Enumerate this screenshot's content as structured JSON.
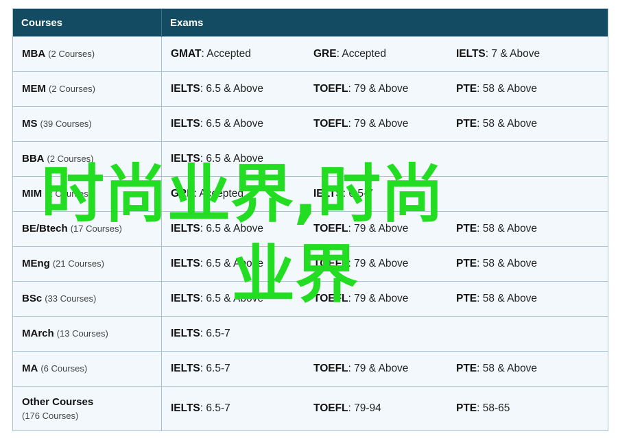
{
  "headers": {
    "courses": "Courses",
    "exams": "Exams"
  },
  "rows": [
    {
      "name": "MBA",
      "count": "(2 Courses)",
      "exams": [
        {
          "name": "GMAT",
          "score": ": Accepted"
        },
        {
          "name": "GRE",
          "score": ": Accepted"
        },
        {
          "name": "IELTS",
          "score": ": 7 & Above"
        }
      ]
    },
    {
      "name": "MEM",
      "count": "(2 Courses)",
      "exams": [
        {
          "name": "IELTS",
          "score": ": 6.5 & Above"
        },
        {
          "name": "TOEFL",
          "score": ": 79 & Above"
        },
        {
          "name": "PTE",
          "score": ": 58 & Above"
        }
      ]
    },
    {
      "name": "MS",
      "count": "(39 Courses)",
      "exams": [
        {
          "name": "IELTS",
          "score": ": 6.5 & Above"
        },
        {
          "name": "TOEFL",
          "score": ": 79 & Above"
        },
        {
          "name": "PTE",
          "score": ": 58 & Above"
        }
      ]
    },
    {
      "name": "BBA",
      "count": "(2 Courses)",
      "exams": [
        {
          "name": "IELTS",
          "score": ": 6.5 & Above"
        },
        {
          "name": "",
          "score": ""
        },
        {
          "name": "",
          "score": ""
        }
      ]
    },
    {
      "name": "MIM",
      "count": "(2 Courses)",
      "exams": [
        {
          "name": "GRE",
          "score": ": Accepted"
        },
        {
          "name": "IELTS",
          "score": ": 6.5-7"
        },
        {
          "name": "",
          "score": ""
        }
      ]
    },
    {
      "name": "BE/Btech",
      "count": "(17 Courses)",
      "exams": [
        {
          "name": "IELTS",
          "score": ": 6.5 & Above"
        },
        {
          "name": "TOEFL",
          "score": ": 79 & Above"
        },
        {
          "name": "PTE",
          "score": ": 58 & Above"
        }
      ]
    },
    {
      "name": "MEng",
      "count": "(21 Courses)",
      "exams": [
        {
          "name": "IELTS",
          "score": ": 6.5 & Above"
        },
        {
          "name": "TOEFL",
          "score": ": 79 & Above"
        },
        {
          "name": "PTE",
          "score": ": 58 & Above"
        }
      ]
    },
    {
      "name": "BSc",
      "count": "(33 Courses)",
      "exams": [
        {
          "name": "IELTS",
          "score": ": 6.5 & Above"
        },
        {
          "name": "TOEFL",
          "score": ": 79 & Above"
        },
        {
          "name": "PTE",
          "score": ": 58 & Above"
        }
      ]
    },
    {
      "name": "MArch",
      "count": "(13 Courses)",
      "exams": [
        {
          "name": "IELTS",
          "score": ": 6.5-7"
        },
        {
          "name": "",
          "score": ""
        },
        {
          "name": "",
          "score": ""
        }
      ]
    },
    {
      "name": "MA",
      "count": "(6 Courses)",
      "exams": [
        {
          "name": "IELTS",
          "score": ": 6.5-7"
        },
        {
          "name": "TOEFL",
          "score": ": 79 & Above"
        },
        {
          "name": "PTE",
          "score": ": 58 & Above"
        }
      ]
    },
    {
      "name": "Other Courses",
      "count": "(176 Courses)",
      "exams": [
        {
          "name": "IELTS",
          "score": ": 6.5-7"
        },
        {
          "name": "TOEFL",
          "score": ": 79-94"
        },
        {
          "name": "PTE",
          "score": ": 58-65"
        }
      ]
    }
  ],
  "watermark": {
    "line1": "时尚业界,时尚",
    "line2": "业界",
    "color": "#22dd22"
  }
}
